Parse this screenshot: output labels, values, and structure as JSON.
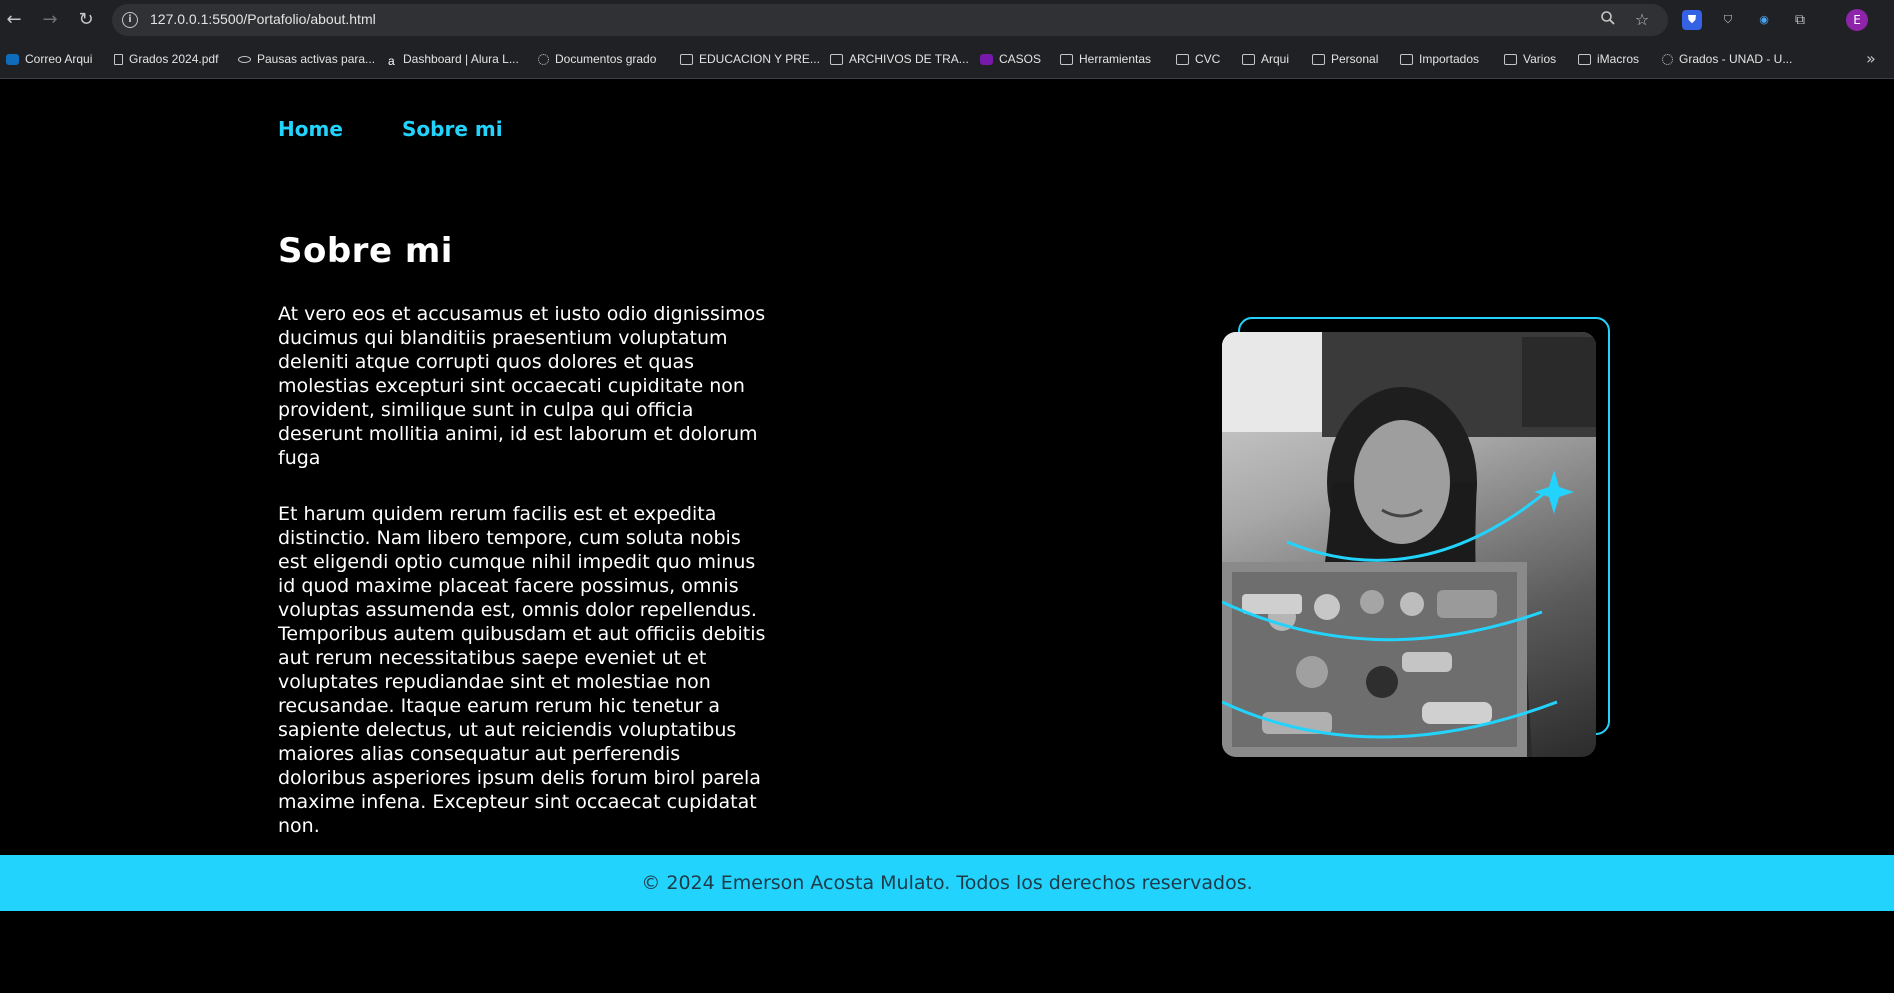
{
  "browser": {
    "url": "127.0.0.1:5500/Portafolio/about.html",
    "profile_initial": "E",
    "bookmarks": [
      {
        "label": "Correo Arqui",
        "icon": "outlook-icon"
      },
      {
        "label": "Grados 2024.pdf",
        "icon": "pdf-icon"
      },
      {
        "label": "Pausas activas para...",
        "icon": "eye-icon"
      },
      {
        "label": "Dashboard | Alura L...",
        "icon": "alura-icon"
      },
      {
        "label": "Documentos grado",
        "icon": "loading-icon"
      },
      {
        "label": "EDUCACION Y PRE...",
        "icon": "folder-icon"
      },
      {
        "label": "ARCHIVOS DE TRA...",
        "icon": "folder-icon"
      },
      {
        "label": "CASOS",
        "icon": "onenote-icon"
      },
      {
        "label": "Herramientas",
        "icon": "folder-icon"
      },
      {
        "label": "CVC",
        "icon": "folder-icon"
      },
      {
        "label": "Arqui",
        "icon": "folder-icon"
      },
      {
        "label": "Personal",
        "icon": "folder-icon"
      },
      {
        "label": "Importados",
        "icon": "folder-icon"
      },
      {
        "label": "Varios",
        "icon": "folder-icon"
      },
      {
        "label": "iMacros",
        "icon": "folder-icon"
      },
      {
        "label": "Grados - UNAD - U...",
        "icon": "loading-icon"
      }
    ]
  },
  "nav": {
    "home": "Home",
    "about": "Sobre mi"
  },
  "main": {
    "title": "Sobre mi",
    "paragraph_1": "At vero eos et accusamus et iusto odio dignissimos ducimus qui blanditiis praesentium voluptatum deleniti atque corrupti quos dolores et quas molestias excepturi sint occaecati cupiditate non provident, similique sunt in culpa qui officia deserunt mollitia animi, id est laborum et dolorum fuga",
    "paragraph_2": "Et harum quidem rerum facilis est et expedita distinctio. Nam libero tempore, cum soluta nobis est eligendi optio cumque nihil impedit quo minus id quod maxime placeat facere possimus, omnis voluptas assumenda est, omnis dolor repellendus. Temporibus autem quibusdam et aut officiis debitis aut rerum necessitatibus saepe eveniet ut et voluptates repudiandae sint et molestiae non recusandae. Itaque earum rerum hic tenetur a sapiente delectus, ut aut reiciendis voluptatibus maiores alias consequatur aut perferendis doloribus asperiores ipsum delis forum birol parela maxime infena. Excepteur sint occaecat cupidatat non."
  },
  "footer": {
    "text": "© 2024 Emerson Acosta Mulato. Todos los derechos reservados."
  },
  "colors": {
    "accent": "#22d4fd",
    "background": "#000000",
    "text": "#ffffff"
  }
}
